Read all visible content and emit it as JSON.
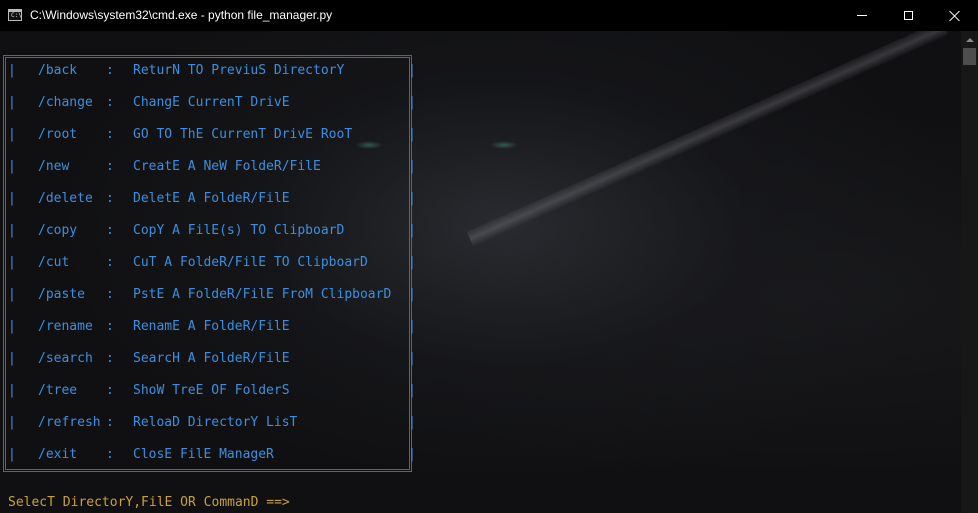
{
  "window": {
    "title": "C:\\Windows\\system32\\cmd.exe - python  file_manager.py",
    "icon_label": "C:\\"
  },
  "menu": [
    {
      "command": "/back",
      "separator": ":",
      "description": "ReturN TO PreviuS DirectorY"
    },
    {
      "command": "/change",
      "separator": ":",
      "description": "ChangE CurrenT DrivE"
    },
    {
      "command": "/root",
      "separator": ":",
      "description": "GO TO ThE CurrenT DrivE RooT"
    },
    {
      "command": "/new",
      "separator": ":",
      "description": "CreatE A NeW FoldeR/FilE"
    },
    {
      "command": "/delete",
      "separator": ":",
      "description": "DeletE A FoldeR/FilE"
    },
    {
      "command": "/copy",
      "separator": ":",
      "description": "CopY A FilE(s) TO ClipboarD"
    },
    {
      "command": "/cut",
      "separator": ":",
      "description": "CuT A FoldeR/FilE TO ClipboarD"
    },
    {
      "command": "/paste",
      "separator": ":",
      "description": "PstE A FoldeR/FilE FroM ClipboarD"
    },
    {
      "command": "/rename",
      "separator": ":",
      "description": "RenamE A FoldeR/FilE"
    },
    {
      "command": "/search",
      "separator": ":",
      "description": "SearcH A FoldeR/FilE"
    },
    {
      "command": "/tree",
      "separator": ":",
      "description": "ShoW TreE OF FolderS"
    },
    {
      "command": "/refresh",
      "separator": ":",
      "description": "ReloaD DirectorY LisT"
    },
    {
      "command": "/exit",
      "separator": ":",
      "description": "ClosE FilE ManageR"
    }
  ],
  "prompt": "SelecT DirectorY,FilE OR CommanD ==>",
  "colors": {
    "menu_text": "#3b8fe0",
    "prompt_text": "#c8a13a",
    "border": "#2e6cc2"
  },
  "icons": {
    "app": "cmd-icon",
    "minimize": "minimize-icon",
    "maximize": "maximize-icon",
    "close": "close-icon",
    "scroll_up": "arrow-up-icon"
  }
}
